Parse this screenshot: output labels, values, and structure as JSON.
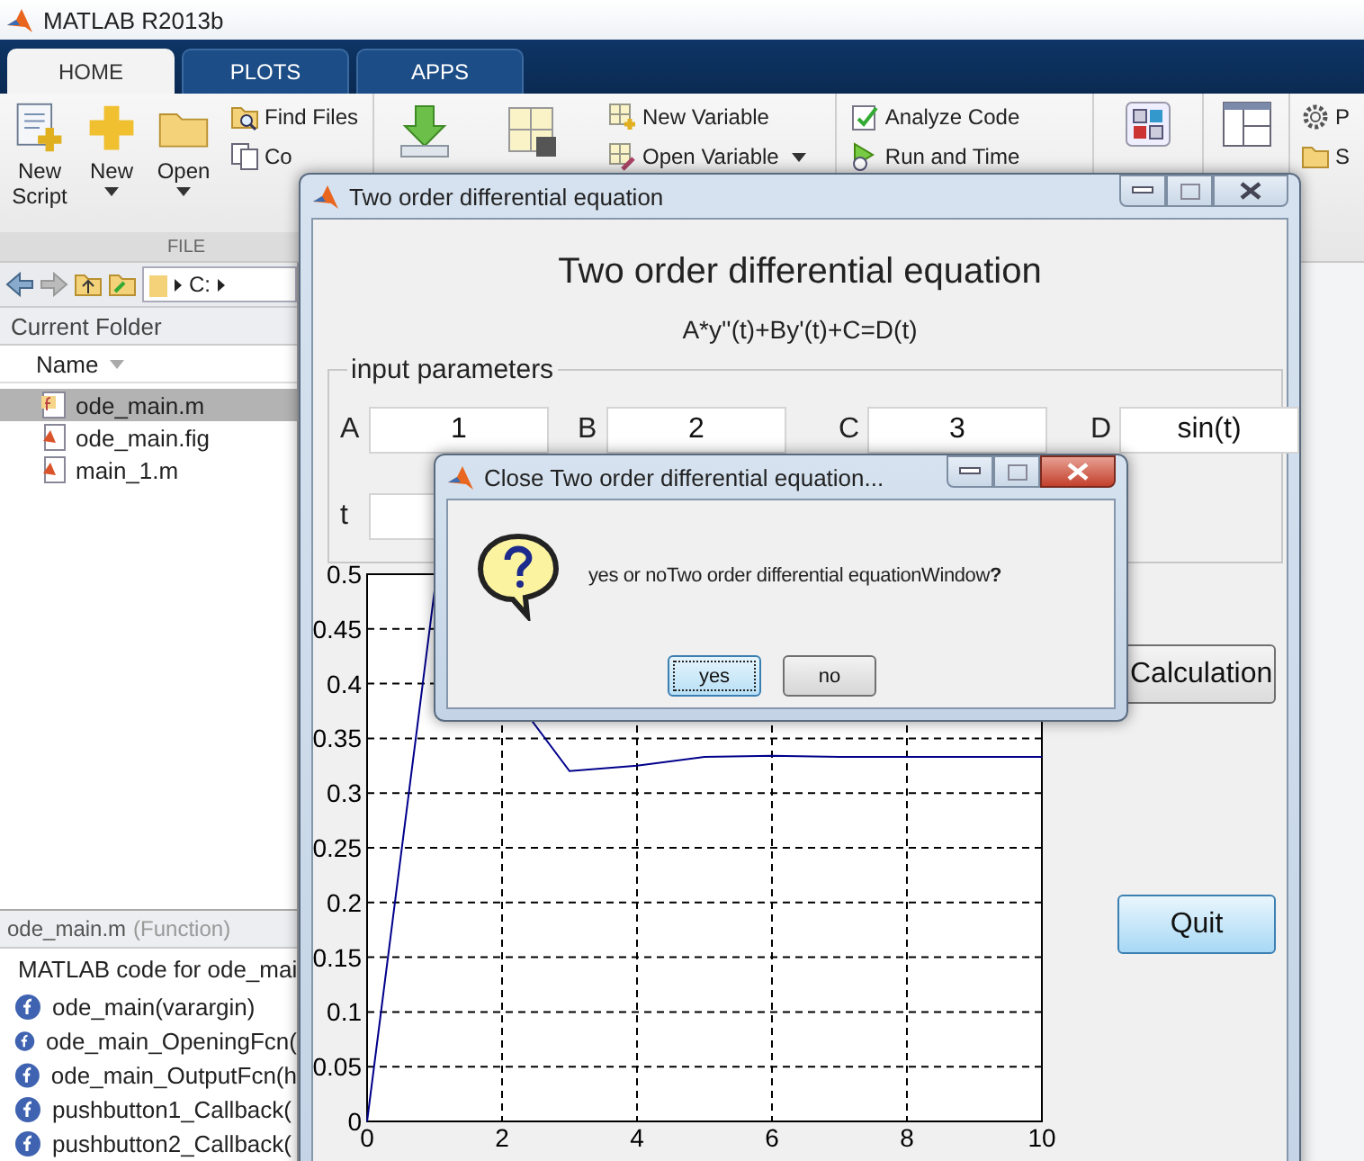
{
  "app": {
    "title": "MATLAB R2013b"
  },
  "tabs": [
    {
      "label": "HOME",
      "selected": true
    },
    {
      "label": "PLOTS",
      "selected": false
    },
    {
      "label": "APPS",
      "selected": false
    }
  ],
  "ribbon": {
    "large_buttons": [
      {
        "label": "New Script",
        "kind": "new-script",
        "menu": false
      },
      {
        "label": "New",
        "kind": "new",
        "menu": true
      },
      {
        "label": "Open",
        "kind": "open",
        "menu": true
      }
    ],
    "file_small": [
      {
        "label": "Find Files",
        "kind": "find"
      },
      {
        "label": "Co",
        "kind": "compare"
      }
    ],
    "section_label": "FILE",
    "variable_small": [
      {
        "label": "New Variable",
        "kind": "new-var",
        "menu": false
      },
      {
        "label": "Open Variable",
        "kind": "open-var",
        "menu": true
      }
    ],
    "code_small": [
      {
        "label": "Analyze Code",
        "kind": "analyze",
        "menu": false
      },
      {
        "label": "Run and Time",
        "kind": "run-time",
        "menu": false
      }
    ],
    "env_small": [
      {
        "label": "P",
        "kind": "gear",
        "menu": false
      },
      {
        "label": "S",
        "kind": "folder",
        "menu": false
      }
    ]
  },
  "address": {
    "path": "C:"
  },
  "current_folder": {
    "title": "Current Folder",
    "column": "Name",
    "files": [
      {
        "name": "ode_main.m",
        "kind": "function",
        "selected": true
      },
      {
        "name": "ode_main.fig",
        "kind": "document",
        "selected": false
      },
      {
        "name": "main_1.m",
        "kind": "document",
        "selected": false
      }
    ]
  },
  "details": {
    "file": "ode_main.m",
    "type": "(Function)",
    "description": "MATLAB code for ode_mai",
    "functions": [
      "ode_main(varargin)",
      "ode_main_OpeningFcn(",
      "ode_main_OutputFcn(h",
      "pushbutton1_Callback(",
      "pushbutton2_Callback("
    ]
  },
  "figure_window": {
    "title": "Two order differential equation",
    "heading": "Two order differential equation",
    "formula": "A*y''(t)+By'(t)+C=D(t)",
    "group_title": "input parameters",
    "params": [
      {
        "label": "A",
        "value": "1"
      },
      {
        "label": "B",
        "value": "2"
      },
      {
        "label": "C",
        "value": "3"
      },
      {
        "label": "D",
        "value": "sin(t)"
      },
      {
        "label": "t"
      }
    ],
    "buttons": [
      {
        "label": "Calculation",
        "highlighted": false
      },
      {
        "label": "Quit",
        "highlighted": true
      }
    ],
    "chart_data": {
      "type": "line",
      "grid": true,
      "x": [
        0,
        1,
        3,
        4,
        5,
        6,
        7,
        8,
        9,
        10
      ],
      "xlim": [
        0,
        10
      ],
      "ylim": [
        0,
        0.5
      ],
      "xticks": [
        0,
        2,
        4,
        6,
        8,
        10
      ],
      "yticks": [
        0,
        0.05,
        0.1,
        0.15,
        0.2,
        0.25,
        0.3,
        0.35,
        0.4,
        0.45,
        0.5
      ],
      "series": [
        {
          "color": "#00008b",
          "values": [
            0,
            0.485,
            0.32,
            0.325,
            0.333,
            0.334,
            0.333,
            0.333,
            0.333,
            0.333
          ]
        }
      ]
    }
  },
  "dialog": {
    "title": "Close Two order differential equation...",
    "message": "yes or noTwo order differential equationWindow**?**",
    "buttons": [
      {
        "label": "yes",
        "focused": true
      },
      {
        "label": "no",
        "focused": false
      }
    ]
  }
}
